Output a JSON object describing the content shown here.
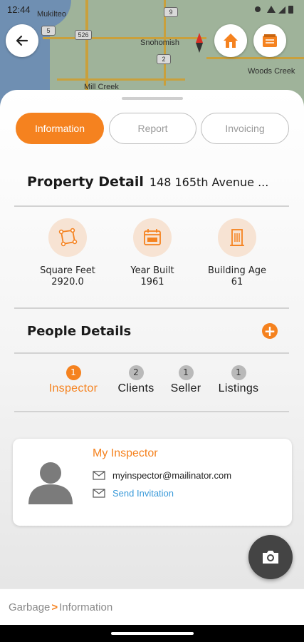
{
  "status_bar": {
    "time": "12:44"
  },
  "map": {
    "labels": [
      "Mukilteo",
      "Snohomish",
      "Woods Creek",
      "Mill Creek"
    ],
    "route_shields": [
      "5",
      "526",
      "9",
      "2"
    ]
  },
  "header": {
    "back_icon": "arrow-left-icon",
    "home_icon": "house-icon",
    "notes_icon": "notebook-icon"
  },
  "tabs": [
    {
      "label": "Information",
      "active": true
    },
    {
      "label": "Report",
      "active": false
    },
    {
      "label": "Invoicing",
      "active": false
    }
  ],
  "property": {
    "title": "Property Detail",
    "address": "148 165th Avenue ...",
    "stats": [
      {
        "label": "Square Feet",
        "value": "2920.0",
        "icon": "area-icon"
      },
      {
        "label": "Year Built",
        "value": "1961",
        "icon": "calendar-icon"
      },
      {
        "label": "Building Age",
        "value": "61",
        "icon": "building-icon"
      }
    ]
  },
  "people": {
    "title": "People Details",
    "add_label": "+",
    "tabs": [
      {
        "count": "1",
        "label": "Inspector",
        "active": true
      },
      {
        "count": "2",
        "label": "Clients",
        "active": false
      },
      {
        "count": "1",
        "label": "Seller",
        "active": false
      },
      {
        "count": "1",
        "label": "Listings",
        "active": false
      }
    ],
    "card": {
      "role": "My Inspector",
      "email": "myinspector@mailinator.com",
      "invite_label": "Send Invitation"
    }
  },
  "breadcrumb": {
    "root": "Garbage",
    "separator": ">",
    "current": "Information"
  },
  "colors": {
    "accent": "#f5821f",
    "link": "#3a9ad9"
  }
}
